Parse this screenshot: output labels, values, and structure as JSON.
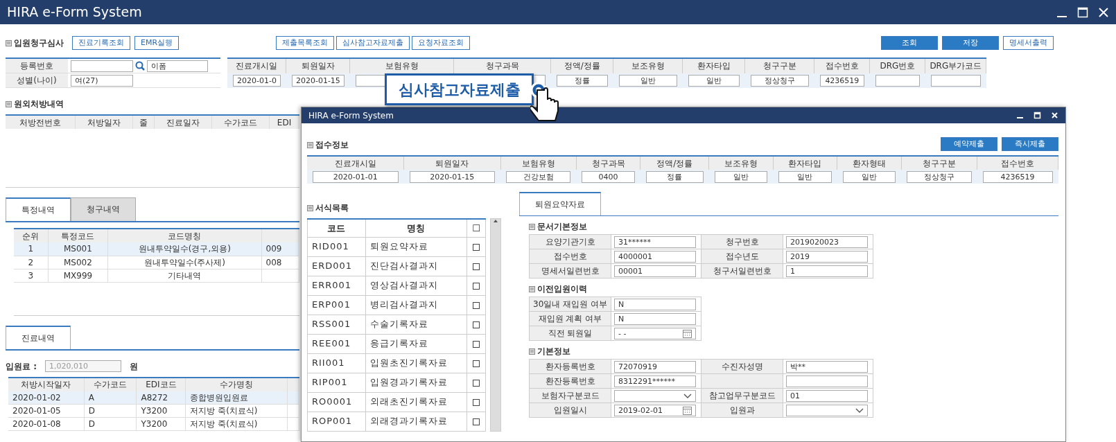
{
  "window": {
    "title": "HIRA e-Form System"
  },
  "toolbar": {
    "title": "입원청구심사",
    "left_buttons": [
      {
        "label": "진료기록조회",
        "kind": "outline"
      },
      {
        "label": "EMR실행",
        "kind": "outline"
      }
    ],
    "center_buttons": [
      {
        "label": "제출목록조회",
        "kind": "outline"
      },
      {
        "label": "심사참고자료제출",
        "kind": "outline"
      },
      {
        "label": "요청자료조회",
        "kind": "outline"
      }
    ],
    "right_buttons": [
      {
        "label": "조회",
        "kind": "primary"
      },
      {
        "label": "저장",
        "kind": "primary"
      },
      {
        "label": "명세서출력",
        "kind": "outline"
      }
    ]
  },
  "patient": {
    "registration_label": "등록번호",
    "name_value": "이폼",
    "sex_label": "성별(나이)",
    "sex_value": "여(27)"
  },
  "claim_info": {
    "columns": [
      {
        "label": "진료개시일",
        "value": "2020-01-0"
      },
      {
        "label": "퇴원일자",
        "value": "2020-01-15"
      },
      {
        "label": "보험유형"
      },
      {
        "label": "청구과목"
      },
      {
        "label": "정액/정률",
        "value": "정률"
      },
      {
        "label": "보조유형",
        "value": "일반"
      },
      {
        "label": "환자타입",
        "value": "일반"
      },
      {
        "label": "청구구분",
        "value": "정상청구"
      },
      {
        "label": "접수번호",
        "value": "4236519"
      },
      {
        "label": "DRG번호"
      },
      {
        "label": "DRG부가코드"
      }
    ]
  },
  "callout": {
    "text": "심사참고자료제출"
  },
  "prescriptions": {
    "title": "원외처방내역",
    "columns": [
      "처방전번호",
      "처방일자",
      "줄",
      "진료일자",
      "수가코드",
      "EDI"
    ]
  },
  "detail_tabs": [
    {
      "label": "특정내역",
      "selected": true
    },
    {
      "label": "청구내역",
      "selected": false
    }
  ],
  "special_table": {
    "columns": [
      "순위",
      "특정코드",
      "코드명칭"
    ],
    "rows": [
      {
        "cells": [
          "1",
          "MS001",
          "원내투약일수(경구,외용)",
          "009"
        ],
        "selected": true
      },
      {
        "cells": [
          "2",
          "MS002",
          "원내투약일수(주사제)",
          "008"
        ],
        "selected": false
      },
      {
        "cells": [
          "3",
          "MX999",
          "기타내역"
        ],
        "selected": false
      }
    ]
  },
  "treatment_tabs": [
    {
      "label": "진료내역",
      "selected": true
    }
  ],
  "admission_fee": {
    "label": "입원료 :",
    "value": "1,020,010",
    "unit": "원",
    "disabled": true
  },
  "treatment_table": {
    "columns": [
      "처방시작일자",
      "수가코드",
      "EDI코드",
      "수가명칭"
    ],
    "rows": [
      {
        "cells": [
          "2020-01-02",
          "A",
          "A8272",
          "종합병원입원료"
        ],
        "selected": true
      },
      {
        "cells": [
          "2020-01-05",
          "D",
          "Y3200",
          "저지방 죽(치료식)"
        ],
        "selected": false
      },
      {
        "cells": [
          "2020-01-08",
          "D",
          "Y3200",
          "저지방 죽(치료식)"
        ],
        "selected": false
      }
    ]
  },
  "popup": {
    "title": "HIRA e-Form System",
    "buttons": [
      {
        "label": "예약제출",
        "kind": "primary"
      },
      {
        "label": "즉시제출",
        "kind": "primary"
      }
    ],
    "receipt": {
      "title": "접수정보",
      "columns": [
        {
          "label": "진료개시일",
          "value": "2020-01-01"
        },
        {
          "label": "퇴원일자",
          "value": "2020-01-15"
        },
        {
          "label": "보험유형",
          "value": "건강보험"
        },
        {
          "label": "청구과목",
          "value": "0400"
        },
        {
          "label": "정액/정률",
          "value": "정률"
        },
        {
          "label": "보조유형",
          "value": "일반"
        },
        {
          "label": "환자타입",
          "value": "일반"
        },
        {
          "label": "환자형태",
          "value": "일반"
        },
        {
          "label": "청구구분",
          "value": "정상청구"
        },
        {
          "label": "접수번호",
          "value": "4236519"
        }
      ]
    },
    "form_list": {
      "title": "서식목록",
      "columns": [
        "코드",
        "명칭",
        "☐"
      ],
      "rows": [
        {
          "code": "RID001",
          "name": "퇴원요약자료",
          "checked": false
        },
        {
          "code": "ERD001",
          "name": "진단검사결과지",
          "checked": false
        },
        {
          "code": "ERR001",
          "name": "영상검사결과지",
          "checked": false
        },
        {
          "code": "ERP001",
          "name": "병리검사결과지",
          "checked": false
        },
        {
          "code": "RSS001",
          "name": "수술기록자료",
          "checked": false
        },
        {
          "code": "REE001",
          "name": "응급기록자료",
          "checked": false
        },
        {
          "code": "RII001",
          "name": "입원초진기록자료",
          "checked": false
        },
        {
          "code": "RIP001",
          "name": "입원경과기록자료",
          "checked": false
        },
        {
          "code": "RO0001",
          "name": "외래초진기록자료",
          "checked": false
        },
        {
          "code": "ROP001",
          "name": "외래경과기록자료",
          "checked": false
        }
      ]
    },
    "doc_tabs": [
      {
        "label": "퇴원요약자료",
        "selected": true
      }
    ],
    "sections": [
      {
        "title": "문서기본정보",
        "rows": [
          {
            "fields": [
              {
                "label": "요양기관기호",
                "value": "31******",
                "kind": "text"
              },
              {
                "label": "청구번호",
                "value": "2019020023",
                "kind": "text"
              }
            ]
          },
          {
            "fields": [
              {
                "label": "접수번호",
                "value": "4000001",
                "kind": "text"
              },
              {
                "label": "접수년도",
                "value": "2019",
                "kind": "text"
              }
            ]
          },
          {
            "fields": [
              {
                "label": "명세서일련번호",
                "value": "00001",
                "kind": "text"
              },
              {
                "label": "청구서일련번호",
                "value": "1",
                "kind": "text"
              }
            ]
          }
        ]
      },
      {
        "title": "이전입원이력",
        "rows": [
          {
            "fields": [
              {
                "label": "30일내 재입원 여부",
                "value": "N",
                "kind": "text"
              }
            ]
          },
          {
            "fields": [
              {
                "label": "재입원 계획 여부",
                "value": "N",
                "kind": "text"
              }
            ]
          },
          {
            "fields": [
              {
                "label": "직전 퇴원일",
                "value": "- -",
                "kind": "date"
              }
            ]
          }
        ]
      },
      {
        "title": "기본정보",
        "rows": [
          {
            "fields": [
              {
                "label": "환자등록번호",
                "value": "72070919",
                "kind": "text"
              },
              {
                "label": "수진자성명",
                "value": "박**",
                "kind": "text"
              }
            ]
          },
          {
            "fields": [
              {
                "label": "환잔등록번호",
                "value": "8312291******",
                "kind": "text"
              },
              {
                "kind": "text"
              }
            ]
          },
          {
            "fields": [
              {
                "label": "보험자구분코드",
                "kind": "select"
              },
              {
                "label": "참고업무구분코드",
                "value": "01",
                "kind": "text"
              }
            ]
          },
          {
            "fields": [
              {
                "label": "입원일시",
                "value": "2019-02-01",
                "kind": "date"
              },
              {
                "label": "입원과",
                "kind": "select"
              }
            ]
          }
        ]
      }
    ]
  }
}
